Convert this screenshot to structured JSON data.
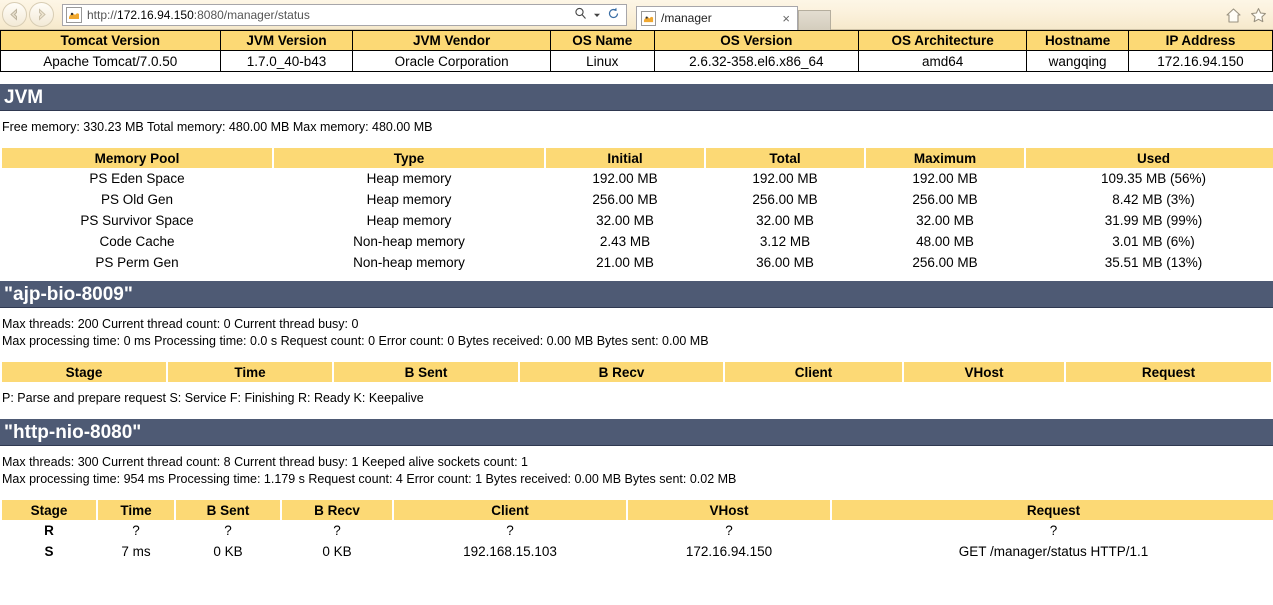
{
  "browser": {
    "back_label": "Back",
    "forward_label": "Forward",
    "url_prefix": "http://",
    "url_host": "172.16.94.150",
    "url_suffix": ":8080/manager/status",
    "url_full": "http://172.16.94.150:8080/manager/status",
    "search_icon": "search-icon",
    "dropdown_icon": "chevron-down-icon",
    "refresh_icon": "refresh-icon",
    "tab_title": "/manager",
    "tab_close_label": "×",
    "home_icon": "home-icon",
    "favorites_icon": "star-icon",
    "favicon": "tomcat-favicon"
  },
  "server_info": {
    "headers": [
      "Tomcat Version",
      "JVM Version",
      "JVM Vendor",
      "OS Name",
      "OS Version",
      "OS Architecture",
      "Hostname",
      "IP Address"
    ],
    "values": [
      "Apache Tomcat/7.0.50",
      "1.7.0_40-b43",
      "Oracle Corporation",
      "Linux",
      "2.6.32-358.el6.x86_64",
      "amd64",
      "wangqing",
      "172.16.94.150"
    ]
  },
  "jvm": {
    "section_title": "JVM",
    "summary": "Free memory: 330.23 MB Total memory: 480.00 MB Max memory: 480.00 MB",
    "headers": [
      "Memory Pool",
      "Type",
      "Initial",
      "Total",
      "Maximum",
      "Used"
    ],
    "rows": [
      [
        "PS Eden Space",
        "Heap memory",
        "192.00 MB",
        "192.00 MB",
        "192.00 MB",
        "109.35 MB (56%)"
      ],
      [
        "PS Old Gen",
        "Heap memory",
        "256.00 MB",
        "256.00 MB",
        "256.00 MB",
        "8.42 MB (3%)"
      ],
      [
        "PS Survivor Space",
        "Heap memory",
        "32.00 MB",
        "32.00 MB",
        "32.00 MB",
        "31.99 MB (99%)"
      ],
      [
        "Code Cache",
        "Non-heap memory",
        "2.43 MB",
        "3.12 MB",
        "48.00 MB",
        "3.01 MB (6%)"
      ],
      [
        "PS Perm Gen",
        "Non-heap memory",
        "21.00 MB",
        "36.00 MB",
        "256.00 MB",
        "35.51 MB (13%)"
      ]
    ]
  },
  "connector_ajp": {
    "section_title": "\"ajp-bio-8009\"",
    "line1": "Max threads: 200 Current thread count: 0 Current thread busy: 0",
    "line2": "Max processing time: 0 ms Processing time: 0.0 s Request count: 0 Error count: 0 Bytes received: 0.00 MB Bytes sent: 0.00 MB",
    "headers": [
      "Stage",
      "Time",
      "B Sent",
      "B Recv",
      "Client",
      "VHost",
      "Request"
    ],
    "rows": [],
    "legend": "P: Parse and prepare request S: Service F: Finishing R: Ready K: Keepalive"
  },
  "connector_http": {
    "section_title": "\"http-nio-8080\"",
    "line1": "Max threads: 300 Current thread count: 8 Current thread busy: 1 Keeped alive sockets count: 1",
    "line2": "Max processing time: 954 ms Processing time: 1.179 s Request count: 4 Error count: 1 Bytes received: 0.00 MB Bytes sent: 0.02 MB",
    "headers": [
      "Stage",
      "Time",
      "B Sent",
      "B Recv",
      "Client",
      "VHost",
      "Request"
    ],
    "rows": [
      [
        "R",
        "?",
        "?",
        "?",
        "?",
        "?",
        "?"
      ],
      [
        "S",
        "7 ms",
        "0 KB",
        "0 KB",
        "192.168.15.103",
        "172.16.94.150",
        "GET /manager/status HTTP/1.1"
      ]
    ]
  },
  "colors": {
    "header_yellow": "#FCD975",
    "section_blue": "#4E5A74",
    "text_black": "#000000",
    "page_white": "#FFFFFF"
  }
}
